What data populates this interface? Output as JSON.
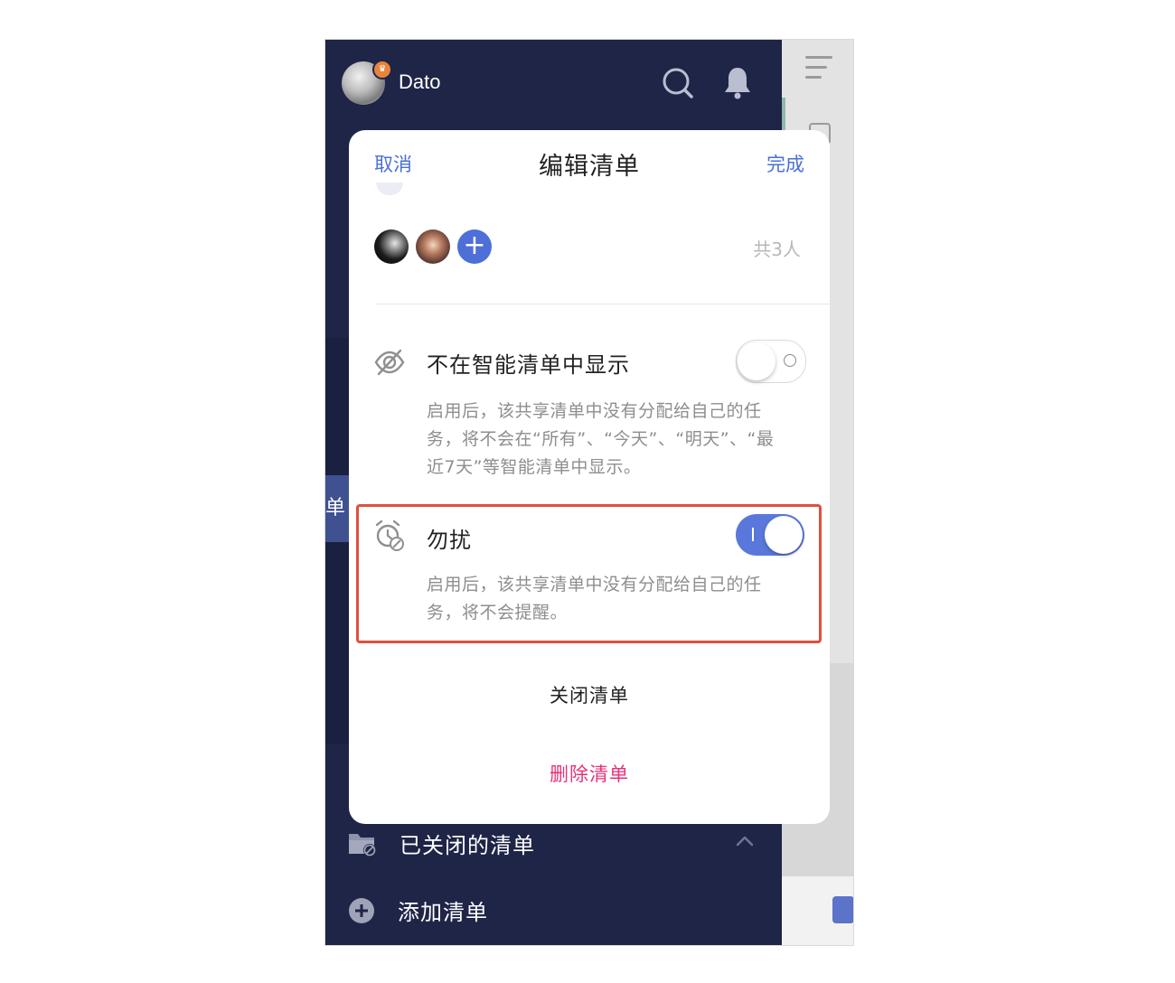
{
  "header": {
    "username": "Dato"
  },
  "drawer": {
    "highlighted_fragment": "清单",
    "closed_lists_label": "已关闭的清单",
    "add_list_label": "添加清单"
  },
  "modal": {
    "cancel_label": "取消",
    "title": "编辑清单",
    "done_label": "完成",
    "member_count": "共3人",
    "hide_smart": {
      "title": "不在智能清单中显示",
      "description": "启用后，该共享清单中没有分配给自己的任务，将不会在“所有”、“今天”、“明天”、“最近7天”等智能清单中显示。",
      "enabled": false
    },
    "do_not_disturb": {
      "title": "勿扰",
      "description": "启用后，该共享清单中没有分配给自己的任务，将不会提醒。",
      "enabled": true
    },
    "close_list_label": "关闭清单",
    "delete_list_label": "删除清单"
  },
  "colors": {
    "accent": "#4a6fd8",
    "drawer_bg": "#1e2547",
    "delete": "#e8317a",
    "highlight_border": "#e0503e"
  }
}
